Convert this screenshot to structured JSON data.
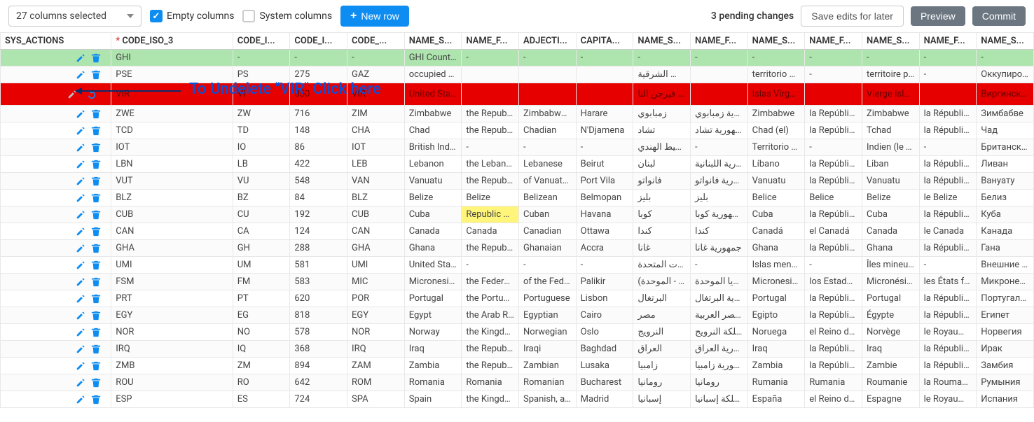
{
  "toolbar": {
    "columns_dropdown": "27 columns selected",
    "empty_columns_label": "Empty columns",
    "system_columns_label": "System columns",
    "new_row_label": "New row",
    "pending_label": "3 pending changes",
    "save_edits_label": "Save edits for later",
    "preview_label": "Preview",
    "commit_label": "Commit"
  },
  "annotation": "To Undelete \"VIR\" Click here",
  "headers": [
    "SYS_ACTIONS",
    "CODE_ISO_3",
    "CODE_I...",
    "CODE_I...",
    "CODE_...",
    "NAME_S...",
    "NAME_F...",
    "ADJECTI...",
    "CAPITA...",
    "NAME_S...",
    "NAME_F...",
    "NAME_S...",
    "NAME_F...",
    "NAME_S...",
    "NAME_F...",
    "NAME_S..."
  ],
  "rows": [
    {
      "status": "new",
      "cells": [
        "GHI",
        "-",
        "-",
        "-",
        "GHI Country",
        "-",
        "-",
        "-",
        "-",
        "-",
        "-",
        "-",
        "-",
        "-",
        "-"
      ]
    },
    {
      "status": "normal",
      "cells": [
        "PSE",
        "PS",
        "275",
        "GAZ",
        "occupied Pal",
        "",
        "",
        "",
        "فيها القدس الشرقية",
        "",
        "territorio pale",
        "-",
        "territoire pale",
        "-",
        "Оккупирован"
      ]
    },
    {
      "status": "deleted",
      "cells": [
        "VIR",
        "VI",
        "850",
        "VIR",
        "United State",
        "",
        "",
        "",
        "جزر فيرجن التا",
        "",
        "Islas Vírgene",
        "",
        "Vierge Island",
        "",
        "Виргинские"
      ]
    },
    {
      "status": "normal",
      "cells": [
        "ZWE",
        "ZW",
        "716",
        "ZIM",
        "Zimbabwe",
        "the Republic",
        "Zimbabwean",
        "Harare",
        "زمبابوي",
        "جمهورية زمبابوي",
        "Zimbabwe",
        "la República",
        "Zimbabwe",
        "la République",
        "Зимбабве"
      ]
    },
    {
      "status": "normal",
      "cells": [
        "TCD",
        "TD",
        "148",
        "CHA",
        "Chad",
        "the Republic",
        "Chadian",
        "N'Djamena",
        "تشاد",
        "جمهورية تشاد",
        "Chad (el)",
        "la República",
        "Tchad",
        "la République",
        "Чад"
      ]
    },
    {
      "status": "normal",
      "cells": [
        "IOT",
        "IO",
        "86",
        "IOT",
        "British Indian",
        "-",
        "-",
        "-",
        "ة في المحيط الهندي",
        "-",
        "Territorio Brit",
        "-",
        "Indien (le Ter",
        "-",
        "Британская"
      ]
    },
    {
      "status": "normal",
      "cells": [
        "LBN",
        "LB",
        "422",
        "LEB",
        "Lebanon",
        "the Lebanese",
        "Lebanese",
        "Beirut",
        "لبنان",
        "الجمهورية اللبنانية",
        "Líbano",
        "la República",
        "Liban",
        "la République",
        "Ливан"
      ]
    },
    {
      "status": "normal",
      "cells": [
        "VUT",
        "VU",
        "548",
        "VAN",
        "Vanuatu",
        "the Republic",
        "of Vanuatu, V",
        "Port Vila",
        "فانواتو",
        "جمهورية فانواتو",
        "Vanuatu",
        "la República",
        "Vanuatu",
        "la République",
        "Вануату"
      ]
    },
    {
      "status": "normal",
      "cells": [
        "BLZ",
        "BZ",
        "84",
        "BLZ",
        "Belize",
        "Belize",
        "Belizean",
        "Belmopan",
        "بليز",
        "بليز",
        "Belice",
        "Belice",
        "Belize",
        "le Belize",
        "Белиз"
      ]
    },
    {
      "status": "normal",
      "edited_col": 5,
      "cells": [
        "CUB",
        "CU",
        "192",
        "CUB",
        "Cuba",
        "Republic of C",
        "Cuban",
        "Havana",
        "كوبا",
        "جمهورية كوبا",
        "Cuba",
        "la República",
        "Cuba",
        "la République",
        "Куба"
      ]
    },
    {
      "status": "normal",
      "cells": [
        "CAN",
        "CA",
        "124",
        "CAN",
        "Canada",
        "Canada",
        "Canadian",
        "Ottawa",
        "كندا",
        "كندا",
        "Canadá",
        "el Canadá",
        "Canada",
        "le Canada",
        "Канада"
      ]
    },
    {
      "status": "normal",
      "cells": [
        "GHA",
        "GH",
        "288",
        "GHA",
        "Ghana",
        "the Republic",
        "Ghanaian",
        "Accra",
        "غانا",
        "جمهورية غانا",
        "Ghana",
        "la República",
        "Ghana",
        "la République",
        "Гана"
      ]
    },
    {
      "status": "normal",
      "cells": [
        "UMI",
        "UM",
        "581",
        "UMI",
        "United States",
        "-",
        "-",
        "-",
        "ية للولايات المتحدة",
        "-",
        "Islas menores",
        "-",
        "Îles mineures",
        "-",
        "Внешние ма"
      ]
    },
    {
      "status": "normal",
      "cells": [
        "FSM",
        "FM",
        "583",
        "MIC",
        "Micronesia (F",
        "the Federate",
        "of the Federa",
        "Palikir",
        "(ولايات - الموحدة)",
        "ميكرونيزيا الموحدة",
        "Micronesia (E",
        "los Estados F",
        "Micronésie (É",
        "les États fédé",
        "Микронезия"
      ]
    },
    {
      "status": "normal",
      "cells": [
        "PRT",
        "PT",
        "620",
        "POR",
        "Portugal",
        "the Portugue",
        "Portuguese",
        "Lisbon",
        "البرتغال",
        "جمهورية البرتغال",
        "Portugal",
        "la República",
        "Portugal",
        "la République",
        "Португалия"
      ]
    },
    {
      "status": "normal",
      "cells": [
        "EGY",
        "EG",
        "818",
        "EGY",
        "Egypt",
        "the Arab Rep",
        "Egyptian",
        "Cairo",
        "مصر",
        "جمهورية مصر العربية",
        "Egipto",
        "la República",
        "Égypte",
        "la République",
        "Египет"
      ]
    },
    {
      "status": "normal",
      "cells": [
        "NOR",
        "NO",
        "578",
        "NOR",
        "Norway",
        "the Kingdom",
        "Norwegian",
        "Oslo",
        "النرويج",
        "مملكة النرويج",
        "Noruega",
        "el Reino de N",
        "Norvège",
        "le Royaume d",
        "Норвегия"
      ]
    },
    {
      "status": "normal",
      "cells": [
        "IRQ",
        "IQ",
        "368",
        "IRQ",
        "Iraq",
        "the Republic",
        "Iraqi",
        "Baghdad",
        "العراق",
        "جمهورية العراق",
        "Iraq",
        "la República",
        "Iraq",
        "la République",
        "Ирак"
      ]
    },
    {
      "status": "normal",
      "cells": [
        "ZMB",
        "ZM",
        "894",
        "ZAM",
        "Zambia",
        "the Republic",
        "Zambian",
        "Lusaka",
        "زامبيا",
        "جمهورية زامبيا",
        "Zambia",
        "la República",
        "Zambie",
        "la République",
        "Замбия"
      ]
    },
    {
      "status": "normal",
      "cells": [
        "ROU",
        "RO",
        "642",
        "ROM",
        "Romania",
        "Romania",
        "Romanian",
        "Bucharest",
        "رومانيا",
        "رومانيا",
        "Rumania",
        "Rumania",
        "Roumanie",
        "la Roumanie",
        "Румыния"
      ]
    },
    {
      "status": "normal",
      "cells": [
        "ESP",
        "ES",
        "724",
        "SPA",
        "Spain",
        "the Kingdom",
        "Spanish, a Sp",
        "Madrid",
        "إسبانيا",
        "مملكة إسبانيا",
        "España",
        "el Reino de E",
        "Espagne",
        "le Royaume d",
        "Испания"
      ]
    }
  ]
}
